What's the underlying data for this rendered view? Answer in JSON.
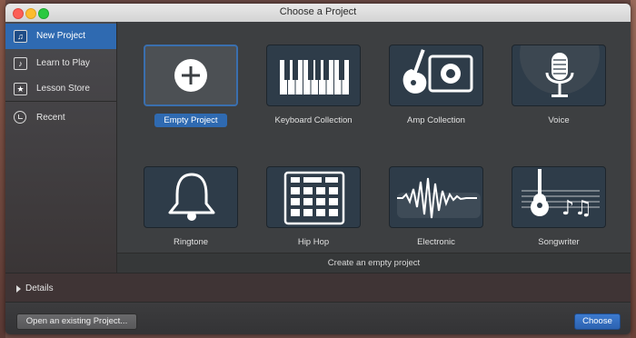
{
  "window": {
    "title": "Choose a Project"
  },
  "sidebar": {
    "items": [
      {
        "label": "New Project",
        "icon": "guitar-file-icon",
        "selected": true
      },
      {
        "label": "Learn to Play",
        "icon": "music-note-icon",
        "selected": false
      },
      {
        "label": "Lesson Store",
        "icon": "star-icon",
        "selected": false
      },
      {
        "label": "Recent",
        "icon": "clock-icon",
        "selected": false
      }
    ]
  },
  "templates": [
    {
      "label": "Empty Project",
      "icon": "plus-icon",
      "selected": true
    },
    {
      "label": "Keyboard Collection",
      "icon": "keyboard-icon",
      "selected": false
    },
    {
      "label": "Amp Collection",
      "icon": "guitar-amp-icon",
      "selected": false
    },
    {
      "label": "Voice",
      "icon": "microphone-icon",
      "selected": false
    },
    {
      "label": "Ringtone",
      "icon": "bell-icon",
      "selected": false
    },
    {
      "label": "Hip Hop",
      "icon": "drum-machine-icon",
      "selected": false
    },
    {
      "label": "Electronic",
      "icon": "waveform-icon",
      "selected": false
    },
    {
      "label": "Songwriter",
      "icon": "acoustic-guitar-icon",
      "selected": false
    }
  ],
  "status": {
    "text": "Create an empty project"
  },
  "details": {
    "label": "Details"
  },
  "buttons": {
    "open": "Open an existing Project...",
    "choose": "Choose"
  },
  "colors": {
    "accent": "#2f6ab1",
    "tile_bg": "#2e3c49",
    "window_bg": "#3b3d3f"
  }
}
